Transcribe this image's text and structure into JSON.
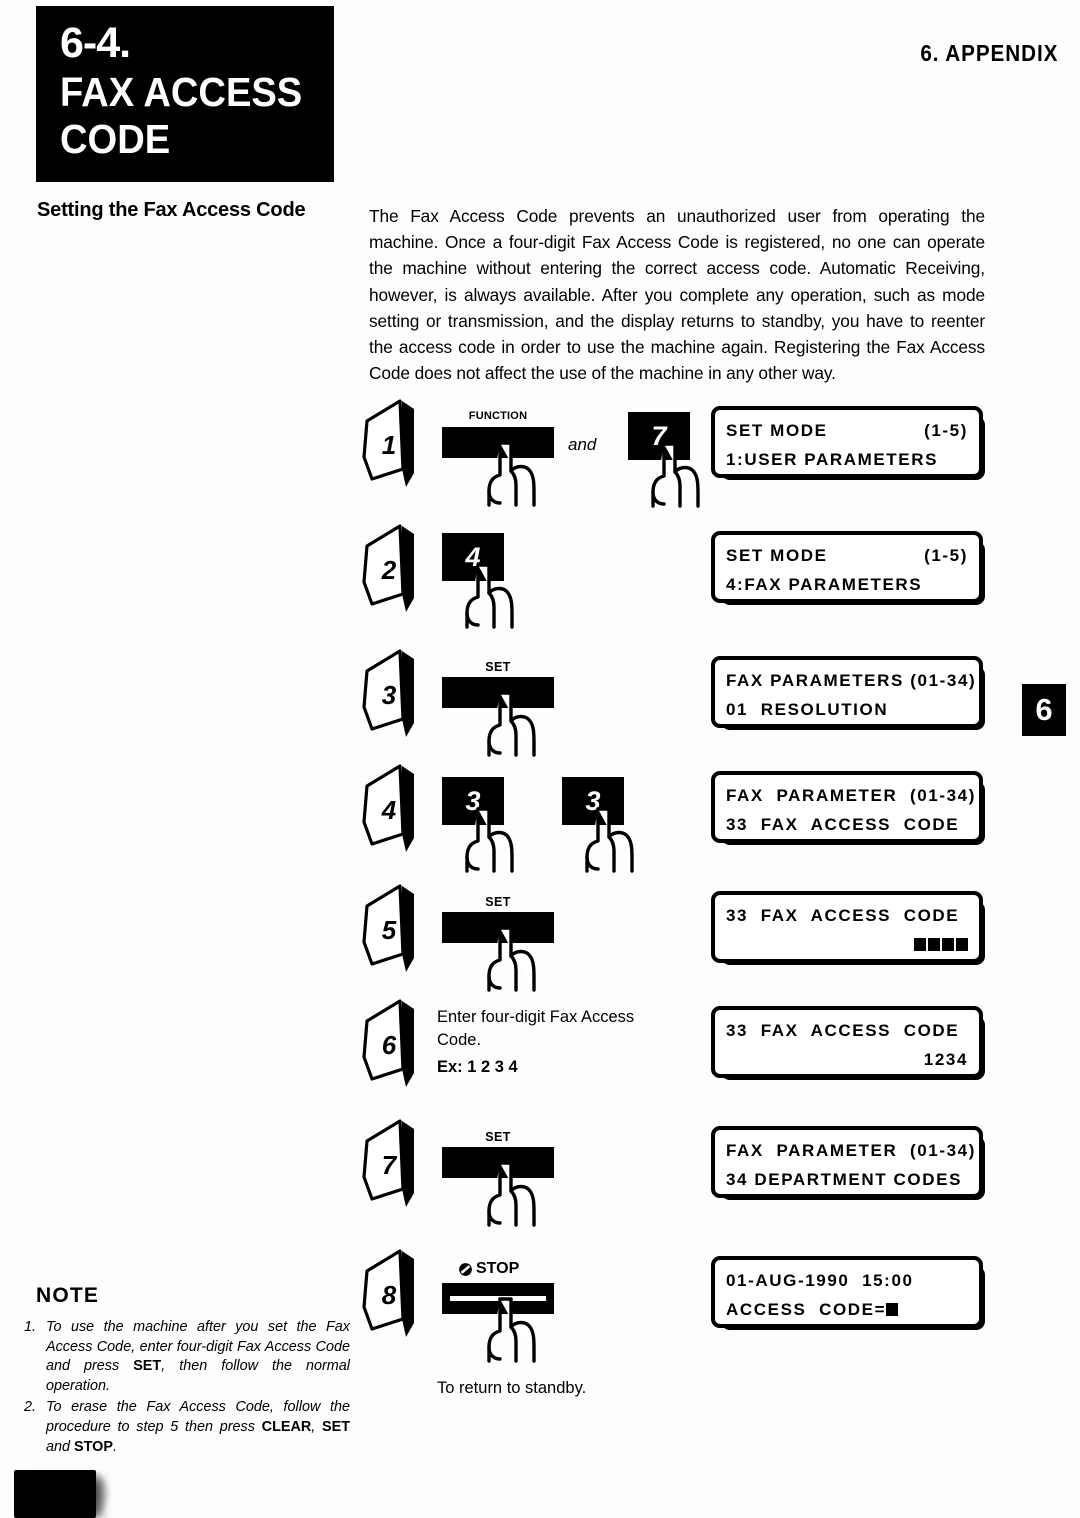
{
  "header": {
    "section_number": "6-4.",
    "title_line1": "FAX ACCESS",
    "title_line2": "CODE",
    "running_head": "6. APPENDIX",
    "chapter_tab": "6"
  },
  "section": {
    "heading": "Setting the Fax Access Code",
    "body": "The Fax Access Code prevents an unauthorized user from operating the machine. Once a four-digit Fax Access Code is registered, no one can operate the machine without entering the correct access code. Automatic Receiving, however, is always available. After you complete any operation, such as mode setting or transmission, and the display returns to standby, you have to reenter the access code in order to use the machine again. Registering the Fax Access Code does not affect the use of the machine in any other way."
  },
  "steps": [
    {
      "number": "1",
      "keys": [
        {
          "type": "bar",
          "label": "FUNCTION"
        },
        {
          "type": "num",
          "label": "7"
        }
      ],
      "conjunction": "and",
      "display": {
        "line1": "SET MODE",
        "line1_right": "(1-5)",
        "line2": "1:USER PARAMETERS"
      }
    },
    {
      "number": "2",
      "keys": [
        {
          "type": "num",
          "label": "4"
        }
      ],
      "display": {
        "line1": "SET MODE",
        "line1_right": "(1-5)",
        "line2": "4:FAX PARAMETERS"
      }
    },
    {
      "number": "3",
      "keys": [
        {
          "type": "bar",
          "label": "SET"
        }
      ],
      "display": {
        "line1": "FAX PARAMETERS (01-34)",
        "line2": "01  RESOLUTION"
      }
    },
    {
      "number": "4",
      "keys": [
        {
          "type": "num",
          "label": "3"
        },
        {
          "type": "num",
          "label": "3"
        }
      ],
      "display": {
        "line1": "FAX  PARAMETER  (01-34)",
        "line2": "33  FAX  ACCESS  CODE"
      }
    },
    {
      "number": "5",
      "keys": [
        {
          "type": "bar",
          "label": "SET"
        }
      ],
      "display": {
        "line1": "33  FAX  ACCESS  CODE",
        "line2_blocks": 4
      }
    },
    {
      "number": "6",
      "instruction": "Enter four-digit Fax Access Code.",
      "example_label": "Ex:",
      "example_value": "1 2 3 4",
      "display": {
        "line1": "33  FAX  ACCESS  CODE",
        "line2_right": "1234"
      }
    },
    {
      "number": "7",
      "keys": [
        {
          "type": "bar",
          "label": "SET"
        }
      ],
      "display": {
        "line1": "FAX  PARAMETER  (01-34)",
        "line2": "34 DEPARTMENT CODES"
      }
    },
    {
      "number": "8",
      "keys": [
        {
          "type": "stop-bar",
          "label": "STOP"
        }
      ],
      "caption": "To return to standby.",
      "display": {
        "line1": "01-AUG-1990  15:00",
        "line2": "ACCESS  CODE=",
        "line2_blocks": 1
      }
    }
  ],
  "note": {
    "title": "NOTE",
    "items": [
      {
        "index": "1.",
        "parts": [
          {
            "text": "To use the machine after you set the Fax Access Code, enter four-digit Fax Access Code and press ",
            "bold": false
          },
          {
            "text": "SET",
            "bold": true
          },
          {
            "text": ", then follow the normal operation.",
            "bold": false
          }
        ]
      },
      {
        "index": "2.",
        "parts": [
          {
            "text": "To erase the Fax Access Code, follow the procedure to step 5 then press ",
            "bold": false
          },
          {
            "text": "CLEAR",
            "bold": true
          },
          {
            "text": ", ",
            "bold": false
          },
          {
            "text": "SET",
            "bold": true
          },
          {
            "text": " and ",
            "bold": false
          },
          {
            "text": "STOP",
            "bold": true
          },
          {
            "text": ".",
            "bold": false
          }
        ]
      }
    ]
  }
}
